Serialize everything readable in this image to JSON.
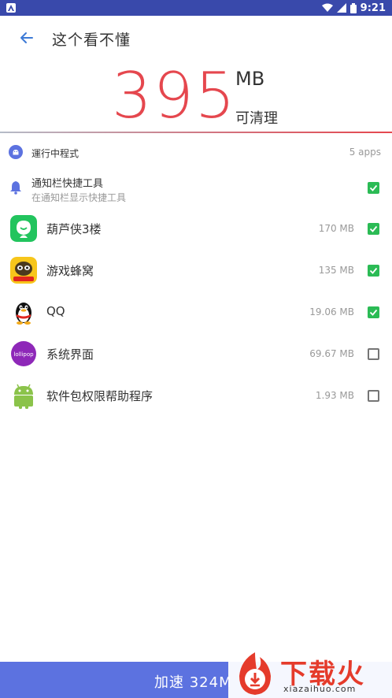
{
  "status_bar": {
    "time": "9:21",
    "bg_color": "#3949ab",
    "icons": [
      "wifi-icon",
      "signal-icon",
      "battery-icon"
    ]
  },
  "header": {
    "title": "这个看不懂",
    "back_icon": "arrow-left-icon"
  },
  "summary": {
    "amount": "395",
    "unit": "MB",
    "cleanable_label": "可清理",
    "accent_color": "#e5474e"
  },
  "running_section": {
    "label": "運行中程式",
    "count": "5 apps",
    "icon": "android-icon"
  },
  "notification_tool": {
    "title": "通知栏快捷工具",
    "subtitle": "在通知栏显示快捷工具",
    "checked": true,
    "icon": "bell-icon"
  },
  "apps": [
    {
      "name": "葫芦侠3楼",
      "size": "170 MB",
      "checked": true,
      "icon": "huluxia-icon"
    },
    {
      "name": "游戏蜂窝",
      "size": "135 MB",
      "checked": true,
      "icon": "bee-icon"
    },
    {
      "name": "QQ",
      "size": "19.06 MB",
      "checked": true,
      "icon": "qq-penguin-icon"
    },
    {
      "name": "系统界面",
      "size": "69.67 MB",
      "checked": false,
      "icon": "lollipop-icon",
      "icon_text": "lollipop"
    },
    {
      "name": "软件包权限帮助程序",
      "size": "1.93 MB",
      "checked": false,
      "icon": "android-robot-icon"
    }
  ],
  "bottom_bar": {
    "label": "加速 324M",
    "bg_color": "#5c72e0"
  },
  "watermark": {
    "text": "下载火",
    "url": "xiazaihuo.com"
  }
}
